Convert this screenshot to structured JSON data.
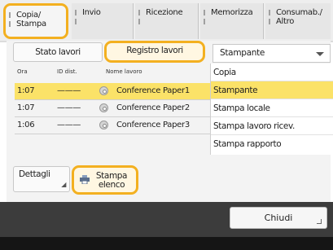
{
  "tabs": [
    {
      "line1": "Copia/",
      "line2": "Stampa"
    },
    {
      "line1": "Invio",
      "line2": ""
    },
    {
      "line1": "Ricezione",
      "line2": ""
    },
    {
      "line1": "Memorizza",
      "line2": ""
    },
    {
      "line1": "Consumab./",
      "line2": "Altro"
    }
  ],
  "buttons": {
    "stato_lavori": "Stato lavori",
    "registro_lavori": "Registro lavori",
    "dettagli": "Dettagli",
    "stampa_elenco_1": "Stampa",
    "stampa_elenco_2": "elenco",
    "chiudi": "Chiudi"
  },
  "filter": {
    "selected": "Stampante",
    "options": [
      "Copia",
      "Stampante",
      "Stampa locale",
      "Stampa lavoro ricev.",
      "Stampa rapporto"
    ]
  },
  "table": {
    "headers": {
      "ora": "Ora",
      "id": "ID dist.",
      "nome": "Nome lavoro"
    },
    "rows": [
      {
        "ora": "1:07",
        "id": "———",
        "nome": "Conference Paper1"
      },
      {
        "ora": "1:07",
        "id": "———",
        "nome": "Conference Paper2"
      },
      {
        "ora": "1:06",
        "id": "———",
        "nome": "Conference Paper3"
      }
    ]
  },
  "colors": {
    "highlight": "#f3b020",
    "selection": "#fbe268"
  }
}
